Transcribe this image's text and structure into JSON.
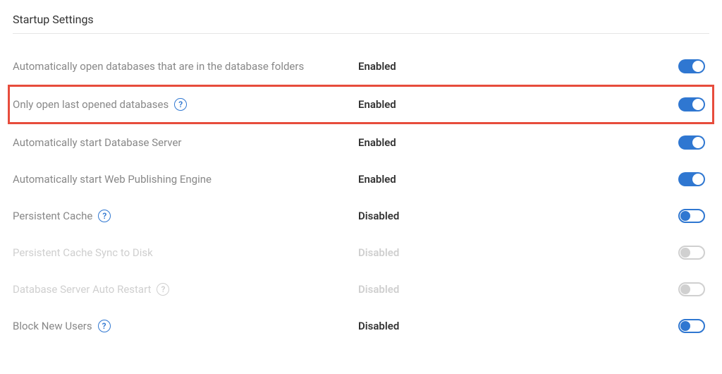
{
  "section_title": "Startup Settings",
  "settings": [
    {
      "label": "Automatically open databases that are in the database folders",
      "status": "Enabled",
      "toggle": "on",
      "has_help": false,
      "highlighted": false,
      "dimmed": false
    },
    {
      "label": "Only open last opened databases",
      "status": "Enabled",
      "toggle": "on",
      "has_help": true,
      "highlighted": true,
      "dimmed": false
    },
    {
      "label": "Automatically start Database Server",
      "status": "Enabled",
      "toggle": "on",
      "has_help": false,
      "highlighted": false,
      "dimmed": false
    },
    {
      "label": "Automatically start Web Publishing Engine",
      "status": "Enabled",
      "toggle": "on",
      "has_help": false,
      "highlighted": false,
      "dimmed": false
    },
    {
      "label": "Persistent Cache",
      "status": "Disabled",
      "toggle": "off-blue",
      "has_help": true,
      "highlighted": false,
      "dimmed": false
    },
    {
      "label": "Persistent Cache Sync to Disk",
      "status": "Disabled",
      "toggle": "off-gray",
      "has_help": false,
      "highlighted": false,
      "dimmed": true
    },
    {
      "label": "Database Server Auto Restart",
      "status": "Disabled",
      "toggle": "off-gray",
      "has_help": true,
      "highlighted": false,
      "dimmed": true
    },
    {
      "label": "Block New Users",
      "status": "Disabled",
      "toggle": "off-blue",
      "has_help": true,
      "highlighted": false,
      "dimmed": false
    }
  ]
}
